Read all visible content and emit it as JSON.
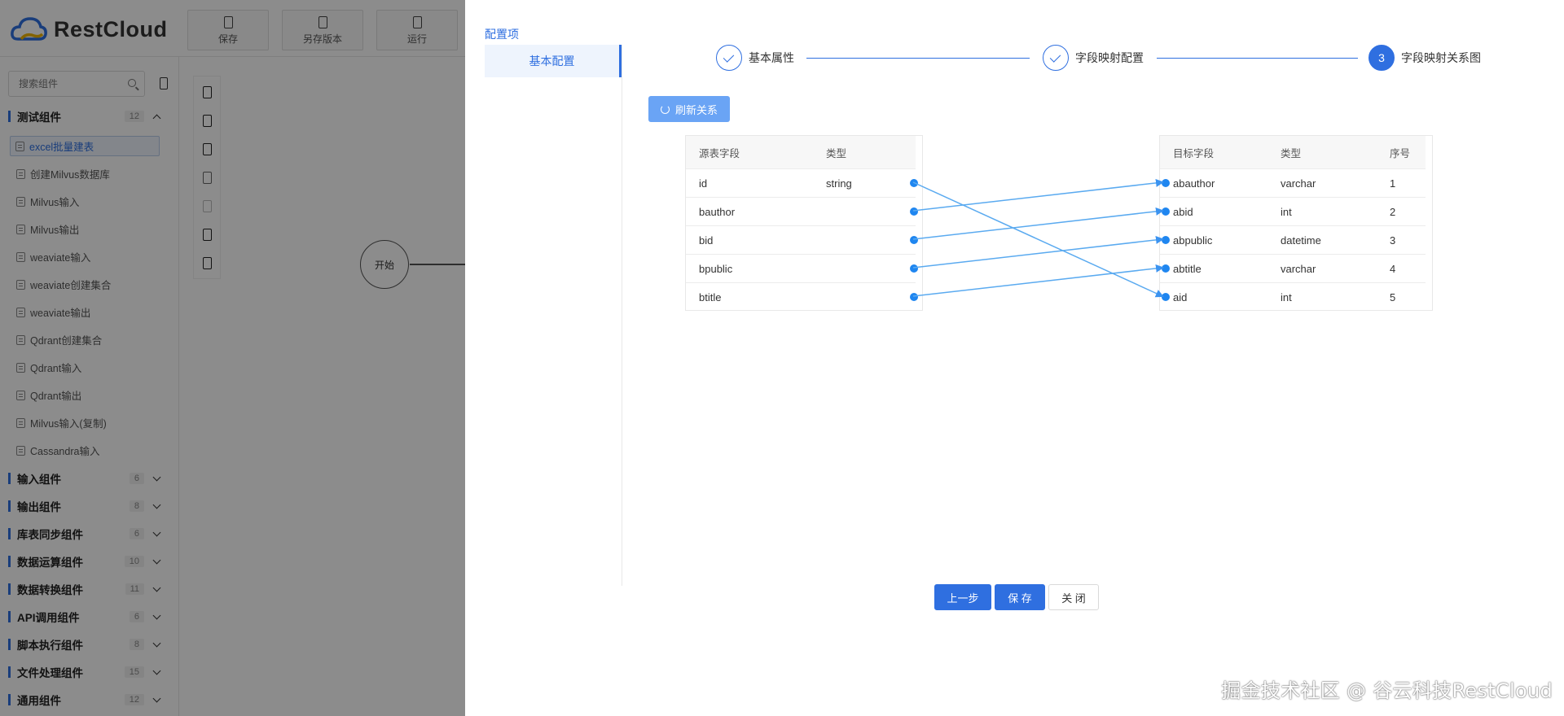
{
  "app": {
    "brand": "RestCloud",
    "toolbar": [
      {
        "label": "保存"
      },
      {
        "label": "另存版本"
      },
      {
        "label": "运行"
      }
    ],
    "search_placeholder": "搜索组件",
    "groups_open": {
      "name": "测试组件",
      "count": "12"
    },
    "items": [
      "excel批量建表",
      "创建Milvus数据库",
      "Milvus输入",
      "Milvus输出",
      "weaviate输入",
      "weaviate创建集合",
      "weaviate输出",
      "Qdrant创建集合",
      "Qdrant输入",
      "Qdrant输出",
      "Milvus输入(复制)",
      "Cassandra输入"
    ],
    "groups": [
      {
        "name": "输入组件",
        "count": "6"
      },
      {
        "name": "输出组件",
        "count": "8"
      },
      {
        "name": "库表同步组件",
        "count": "6"
      },
      {
        "name": "数据运算组件",
        "count": "10"
      },
      {
        "name": "数据转换组件",
        "count": "11"
      },
      {
        "name": "API调用组件",
        "count": "6"
      },
      {
        "name": "脚本执行组件",
        "count": "8"
      },
      {
        "name": "文件处理组件",
        "count": "15"
      },
      {
        "name": "通用组件",
        "count": "12"
      }
    ],
    "start_node": "开始"
  },
  "drawer": {
    "section_title": "配置项",
    "menu_item": "基本配置",
    "steps": [
      {
        "label": "基本属性",
        "state": "done"
      },
      {
        "label": "字段映射配置",
        "state": "done"
      },
      {
        "label": "字段映射关系图",
        "state": "current",
        "number": "3"
      }
    ],
    "refresh_label": "刷新关系",
    "source_table": {
      "headers": [
        "源表字段",
        "类型"
      ],
      "rows": [
        {
          "field": "id",
          "type": "string"
        },
        {
          "field": "bauthor",
          "type": ""
        },
        {
          "field": "bid",
          "type": ""
        },
        {
          "field": "bpublic",
          "type": ""
        },
        {
          "field": "btitle",
          "type": ""
        }
      ]
    },
    "target_table": {
      "headers": [
        "目标字段",
        "类型",
        "序号"
      ],
      "rows": [
        {
          "field": "abauthor",
          "type": "varchar",
          "seq": "1"
        },
        {
          "field": "abid",
          "type": "int",
          "seq": "2"
        },
        {
          "field": "abpublic",
          "type": "datetime",
          "seq": "3"
        },
        {
          "field": "abtitle",
          "type": "varchar",
          "seq": "4"
        },
        {
          "field": "aid",
          "type": "int",
          "seq": "5"
        }
      ]
    },
    "mappings": [
      {
        "source": "id",
        "target": "aid"
      },
      {
        "source": "bauthor",
        "target": "abauthor"
      },
      {
        "source": "bid",
        "target": "abid"
      },
      {
        "source": "bpublic",
        "target": "abpublic"
      },
      {
        "source": "btitle",
        "target": "abtitle"
      }
    ],
    "buttons": {
      "prev": "上一步",
      "save": "保 存",
      "close": "关 闭"
    },
    "link_color": "#5aaaf0",
    "accent": "#2f6fe0"
  },
  "watermark": "掘金技术社区 @ 谷云科技RestCloud"
}
